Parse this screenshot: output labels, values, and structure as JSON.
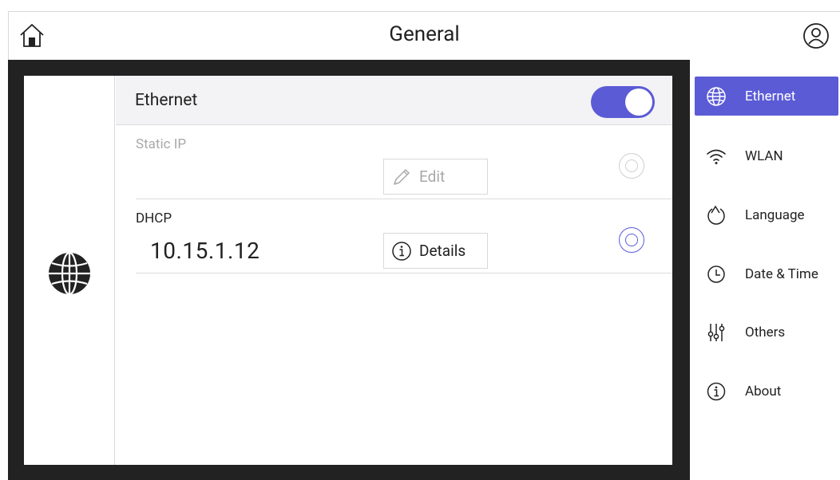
{
  "header": {
    "title": "General"
  },
  "ethernet": {
    "label": "Ethernet",
    "enabled": true
  },
  "options": [
    {
      "title": "Static IP",
      "button_label": "Edit",
      "selected": false,
      "disabled": true
    },
    {
      "title": "DHCP",
      "ip": "10.15.1.12",
      "button_label": "Details",
      "selected": true,
      "disabled": false
    }
  ],
  "sidebar": {
    "items": [
      {
        "label": "Ethernet",
        "icon": "globe-icon",
        "active": true
      },
      {
        "label": "WLAN",
        "icon": "wifi-icon",
        "active": false
      },
      {
        "label": "Language",
        "icon": "language-icon",
        "active": false
      },
      {
        "label": "Date & Time",
        "icon": "clock-icon",
        "active": false
      },
      {
        "label": "Others",
        "icon": "sliders-icon",
        "active": false
      },
      {
        "label": "About",
        "icon": "info-icon",
        "active": false
      }
    ]
  },
  "colors": {
    "accent": "#5b5bd6",
    "frame": "#222222",
    "disabled_text": "#a8a8a8"
  }
}
